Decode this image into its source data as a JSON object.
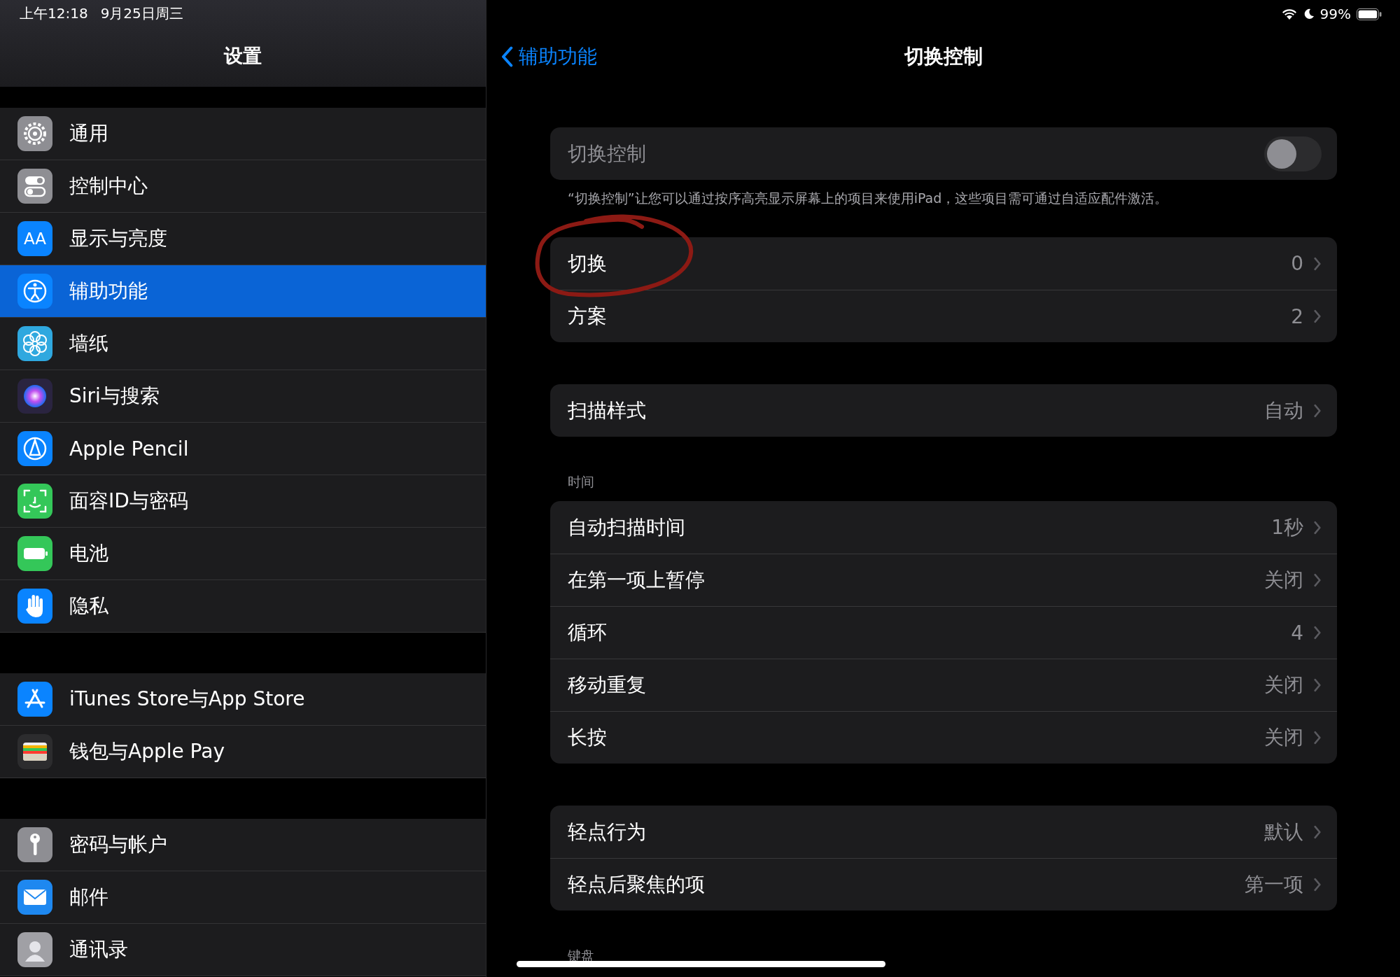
{
  "status_bar": {
    "time": "上午12:18",
    "date": "9月25日周三",
    "battery": "99%"
  },
  "sidebar": {
    "title": "设置",
    "groups": [
      {
        "items": [
          {
            "label": "通用",
            "selected": false
          },
          {
            "label": "控制中心",
            "selected": false
          },
          {
            "label": "显示与亮度",
            "selected": false,
            "icon_text": "AA"
          },
          {
            "label": "辅助功能",
            "selected": true
          },
          {
            "label": "墙纸",
            "selected": false
          },
          {
            "label": "Siri与搜索",
            "selected": false
          },
          {
            "label": "Apple Pencil",
            "selected": false
          },
          {
            "label": "面容ID与密码",
            "selected": false
          },
          {
            "label": "电池",
            "selected": false
          },
          {
            "label": "隐私",
            "selected": false
          }
        ]
      },
      {
        "items": [
          {
            "label": "iTunes Store与App Store",
            "selected": false
          },
          {
            "label": "钱包与Apple Pay",
            "selected": false
          }
        ]
      },
      {
        "items": [
          {
            "label": "密码与帐户",
            "selected": false
          },
          {
            "label": "邮件",
            "selected": false
          },
          {
            "label": "通讯录",
            "selected": false
          }
        ]
      }
    ]
  },
  "nav": {
    "back": "辅助功能",
    "title": "切换控制"
  },
  "sections": [
    {
      "rows": [
        {
          "kind": "toggle",
          "label": "切换控制",
          "on": false,
          "disabled": true
        }
      ],
      "footer": "“切换控制”让您可以通过按序高亮显示屏幕上的项目来使用iPad，这些项目需可通过自适应配件激活。"
    },
    {
      "rows": [
        {
          "kind": "link",
          "label": "切换",
          "value": "0"
        },
        {
          "kind": "link",
          "label": "方案",
          "value": "2"
        }
      ]
    },
    {
      "rows": [
        {
          "kind": "link",
          "label": "扫描样式",
          "value": "自动"
        }
      ]
    },
    {
      "header": "时间",
      "rows": [
        {
          "kind": "link",
          "label": "自动扫描时间",
          "value": "1秒"
        },
        {
          "kind": "link",
          "label": "在第一项上暂停",
          "value": "关闭"
        },
        {
          "kind": "link",
          "label": "循环",
          "value": "4"
        },
        {
          "kind": "link",
          "label": "移动重复",
          "value": "关闭"
        },
        {
          "kind": "link",
          "label": "长按",
          "value": "关闭"
        }
      ]
    },
    {
      "rows": [
        {
          "kind": "link",
          "label": "轻点行为",
          "value": "默认"
        },
        {
          "kind": "link",
          "label": "轻点后聚焦的项",
          "value": "第一项"
        }
      ]
    },
    {
      "header": "键盘"
    }
  ]
}
